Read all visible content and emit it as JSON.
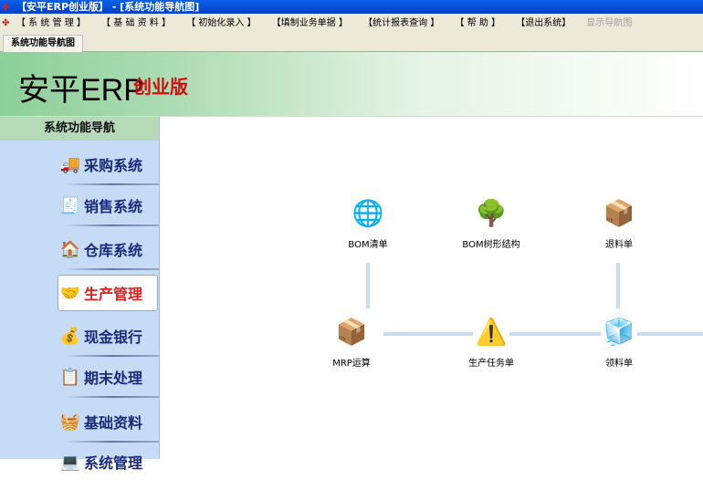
{
  "window": {
    "title": "【安平ERP创业版】 - [系统功能导航图]"
  },
  "menu": [
    {
      "label": "【 系 统 管 理 】",
      "enabled": true
    },
    {
      "label": "【 基 础 资 料 】",
      "enabled": true
    },
    {
      "label": "【 初始化录入 】",
      "enabled": true
    },
    {
      "label": "【填制业务单据 】",
      "enabled": true
    },
    {
      "label": "【统计报表查询 】",
      "enabled": true
    },
    {
      "label": "【 帮 助 】",
      "enabled": true
    },
    {
      "label": "【退出系统】",
      "enabled": true
    },
    {
      "label": "显示导航图",
      "enabled": false
    }
  ],
  "tab": "系统功能导航图",
  "banner": {
    "title": "安平ERP",
    "edition": "创业版"
  },
  "sidebar": {
    "heading": "系统功能导航",
    "items": [
      {
        "label": "采购系统",
        "icon": "truck-icon"
      },
      {
        "label": "销售系统",
        "icon": "hand-receipt-icon"
      },
      {
        "label": "仓库系统",
        "icon": "warehouse-icon"
      },
      {
        "label": "生产管理",
        "icon": "production-icon",
        "active": true
      },
      {
        "label": "现金银行",
        "icon": "cash-icon"
      },
      {
        "label": "期末处理",
        "icon": "checklist-icon"
      },
      {
        "label": "基础资料",
        "icon": "basket-icon"
      },
      {
        "label": "系统管理",
        "icon": "system-icon"
      }
    ]
  },
  "flow": {
    "nodes": [
      {
        "label": "BOM清单",
        "icon": "globe-download-icon"
      },
      {
        "label": "BOM树形结构",
        "icon": "tree-icon"
      },
      {
        "label": "退料单",
        "icon": "return-box-icon"
      },
      {
        "label": "MRP运算",
        "icon": "box-card-icon"
      },
      {
        "label": "生产任务单",
        "icon": "work-sign-icon"
      },
      {
        "label": "领料单",
        "icon": "pick-materials-icon"
      }
    ]
  }
}
